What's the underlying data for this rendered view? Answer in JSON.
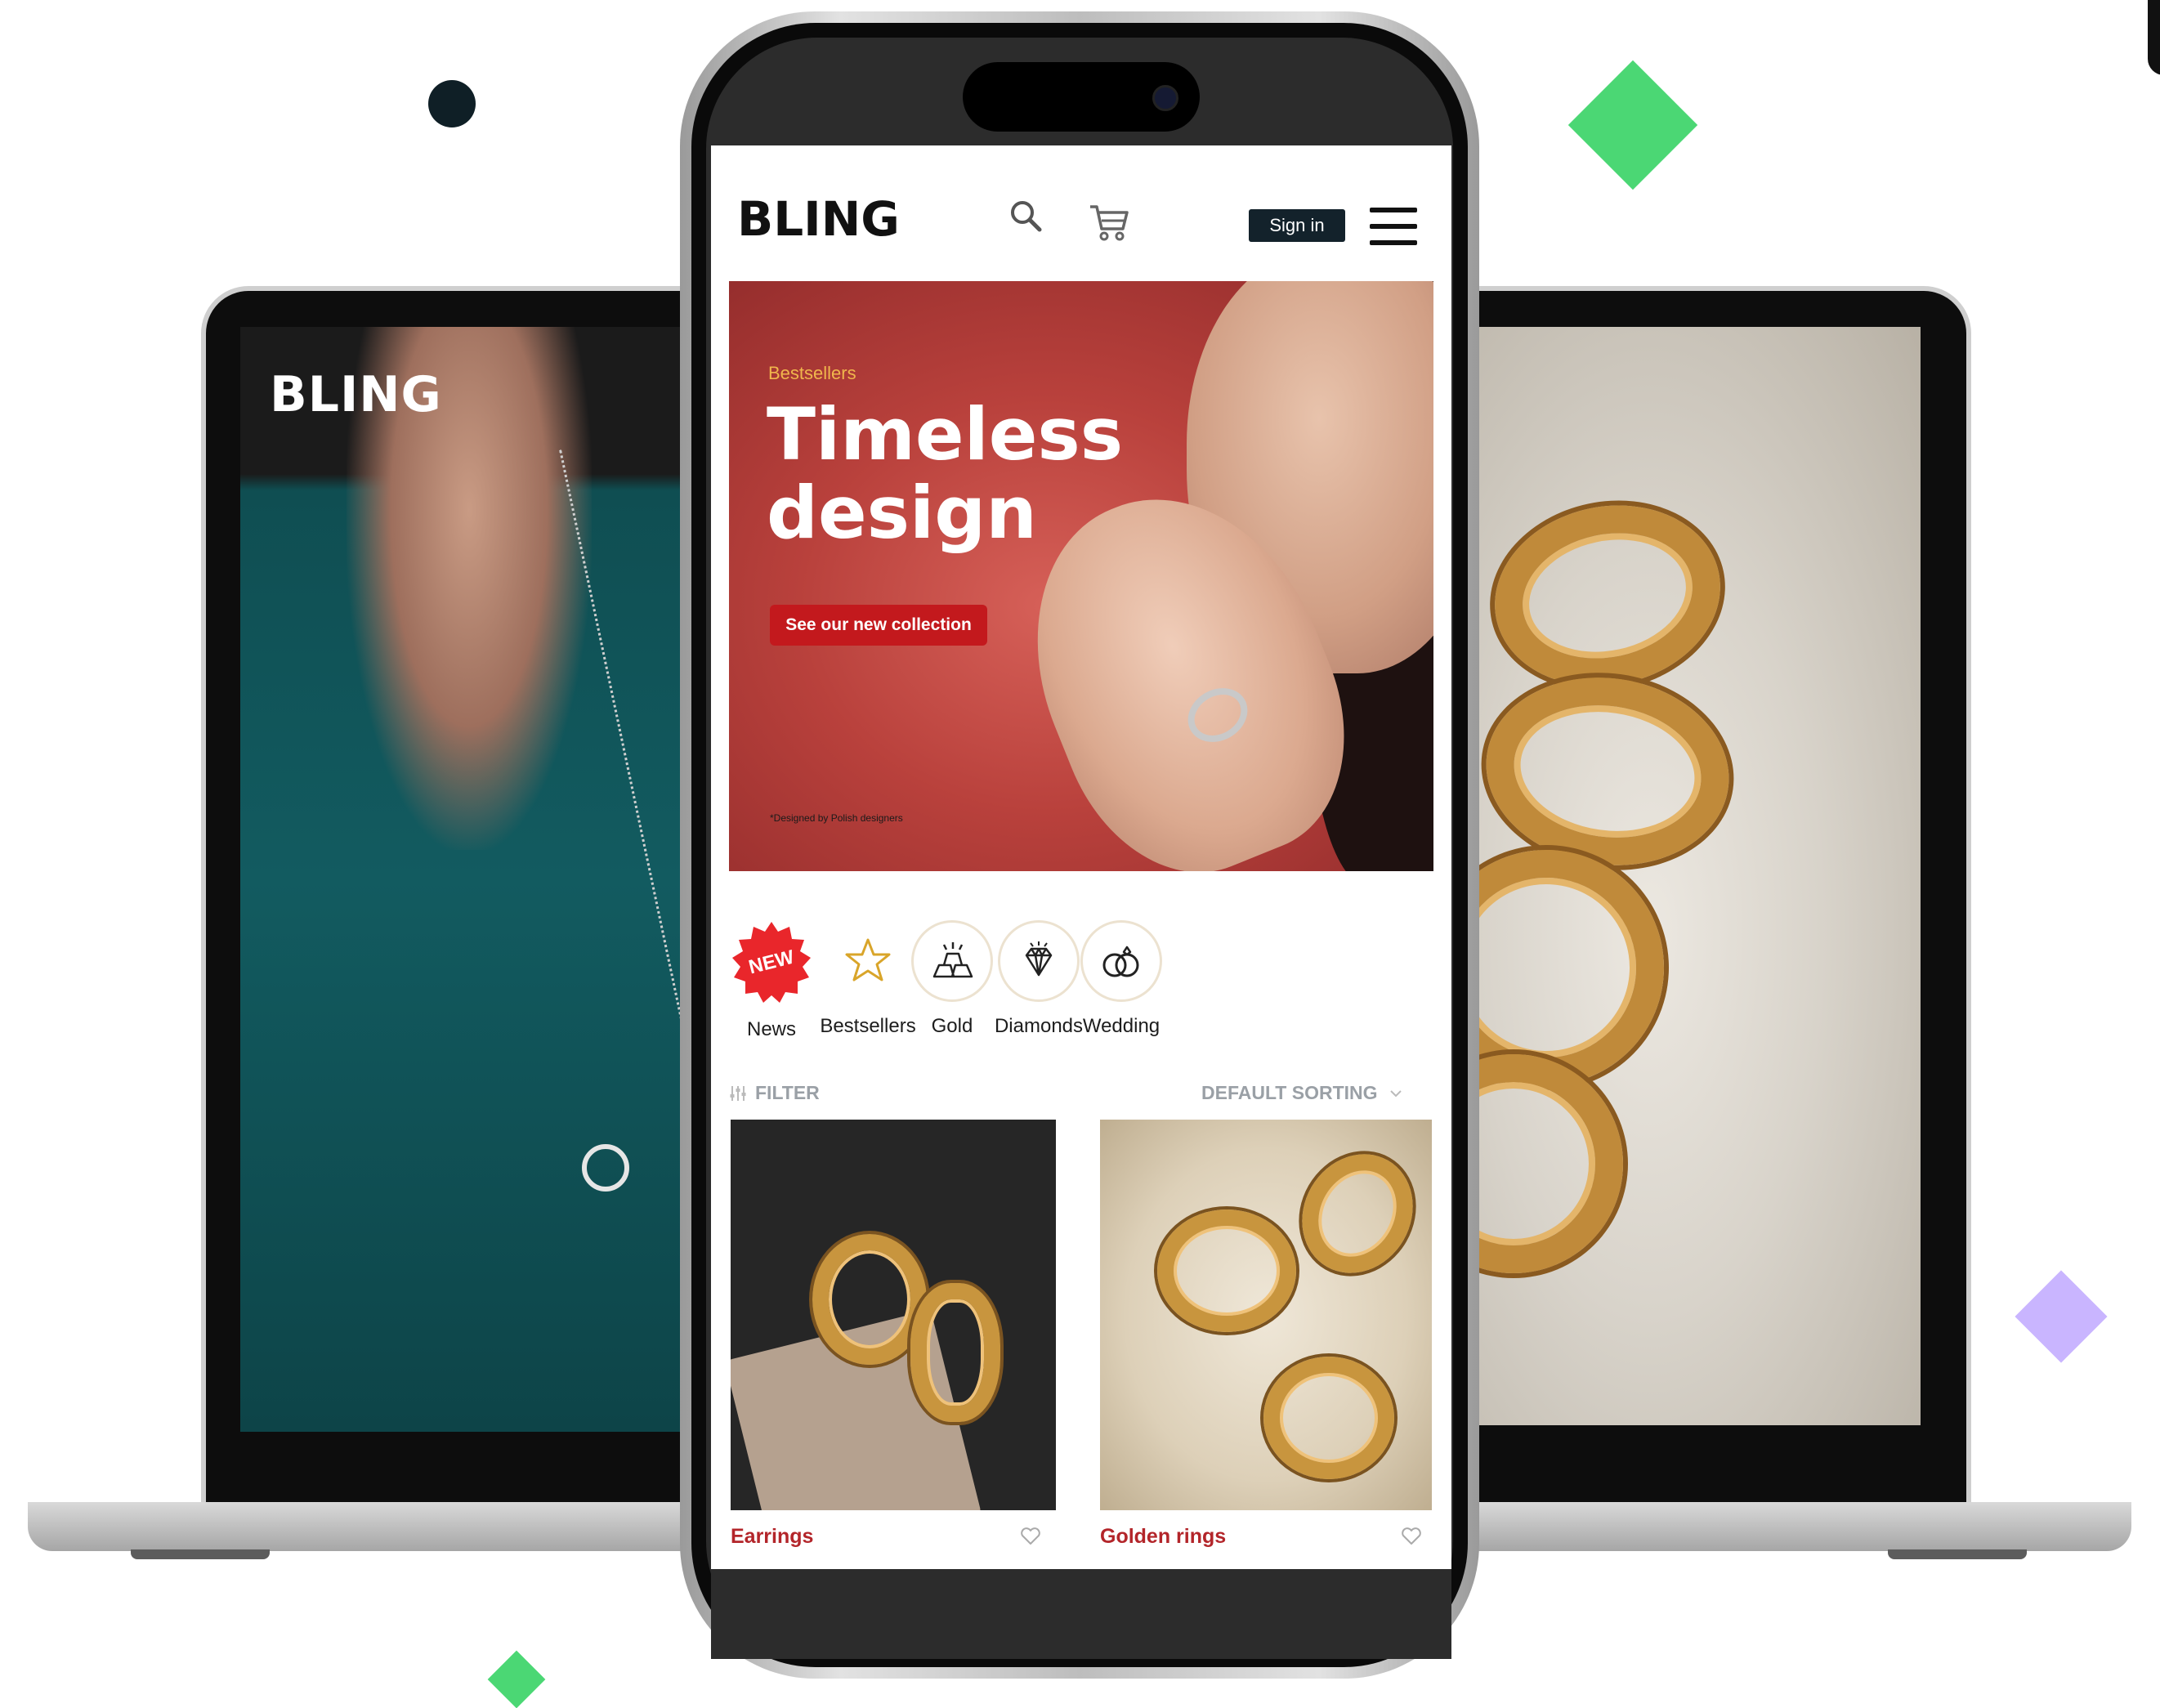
{
  "laptop": {
    "logo": "BLING"
  },
  "app": {
    "logo": "BLING",
    "header": {
      "search_icon": "search-icon",
      "cart_icon": "cart-icon",
      "signin_label": "Sign in",
      "menu_icon": "hamburger-menu-icon"
    },
    "hero": {
      "subtitle": "Bestsellers",
      "title": "Timeless design",
      "cta_label": "See our new collection",
      "note": "*Designed by Polish designers"
    },
    "categories": [
      {
        "label": "News",
        "badge": "NEW",
        "icon": "new-badge-icon"
      },
      {
        "label": "Bestsellers",
        "icon": "star-icon"
      },
      {
        "label": "Gold",
        "icon": "gold-bars-icon"
      },
      {
        "label": "Diamonds",
        "icon": "diamond-icon"
      },
      {
        "label": "Wedding",
        "icon": "wedding-rings-icon"
      }
    ],
    "filter_label": "FILTER",
    "sorting_label": "DEFAULT SORTING",
    "products": [
      {
        "name": "Earrings",
        "icon": "heart-icon"
      },
      {
        "name": "Golden rings",
        "icon": "heart-icon"
      }
    ]
  },
  "colors": {
    "accent_red": "#c3191d",
    "hero_subtitle": "#f0b64c",
    "navy": "#13222b",
    "deco_green": "#4bd774",
    "deco_purple": "#c9b5ff"
  }
}
